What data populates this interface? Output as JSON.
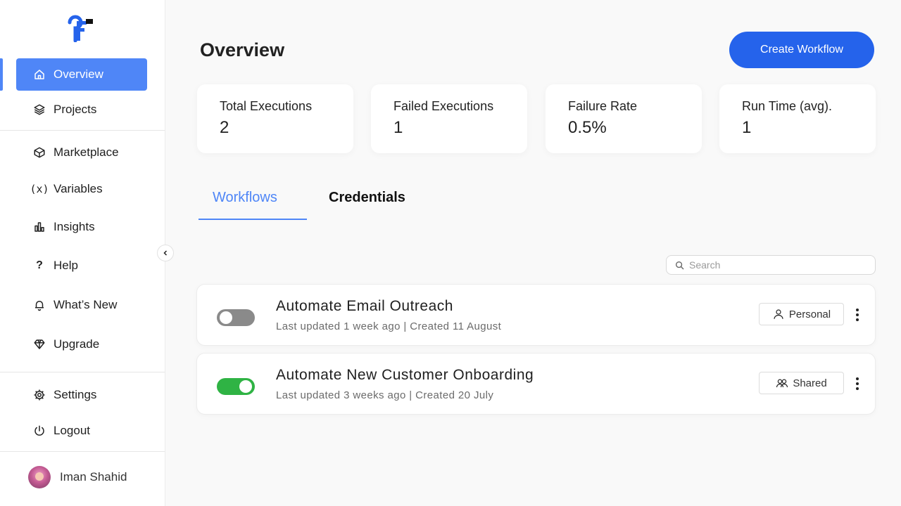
{
  "sidebar": {
    "items": [
      {
        "label": "Overview",
        "icon": "home-icon"
      },
      {
        "label": "Projects",
        "icon": "layers-icon"
      },
      {
        "label": "Marketplace",
        "icon": "box-icon"
      },
      {
        "label": "Variables",
        "icon": "variables-icon",
        "glyph": "(x)"
      },
      {
        "label": "Insights",
        "icon": "bar-chart-icon"
      },
      {
        "label": "Help",
        "icon": "question-icon",
        "glyph": "?"
      },
      {
        "label": "What’s New",
        "icon": "bell-icon"
      },
      {
        "label": "Upgrade",
        "icon": "diamond-icon"
      },
      {
        "label": "Settings",
        "icon": "gear-icon"
      },
      {
        "label": "Logout",
        "icon": "power-icon"
      }
    ],
    "user": {
      "name": "Iman Shahid"
    }
  },
  "header": {
    "title": "Overview",
    "create_button": "Create Workflow"
  },
  "stats": [
    {
      "label": "Total Executions",
      "value": "2"
    },
    {
      "label": "Failed Executions",
      "value": "1"
    },
    {
      "label": "Failure Rate",
      "value": "0.5%"
    },
    {
      "label": "Run Time (avg).",
      "value": "1"
    }
  ],
  "tabs": [
    {
      "label": "Workflows",
      "active": true
    },
    {
      "label": "Credentials",
      "active": false
    }
  ],
  "search": {
    "placeholder": "Search"
  },
  "workflows": [
    {
      "title": "Automate Email Outreach",
      "meta": "Last updated 1 week ago | Created 11 August",
      "enabled": false,
      "badge": "Personal"
    },
    {
      "title": "Automate New Customer Onboarding",
      "meta": "Last updated 3 weeks ago | Created 20 July",
      "enabled": true,
      "badge": "Shared"
    }
  ],
  "colors": {
    "accent": "#4f86f7",
    "primary_button": "#2563eb",
    "toggle_on": "#2fb344",
    "toggle_off": "#8a8a8a"
  }
}
